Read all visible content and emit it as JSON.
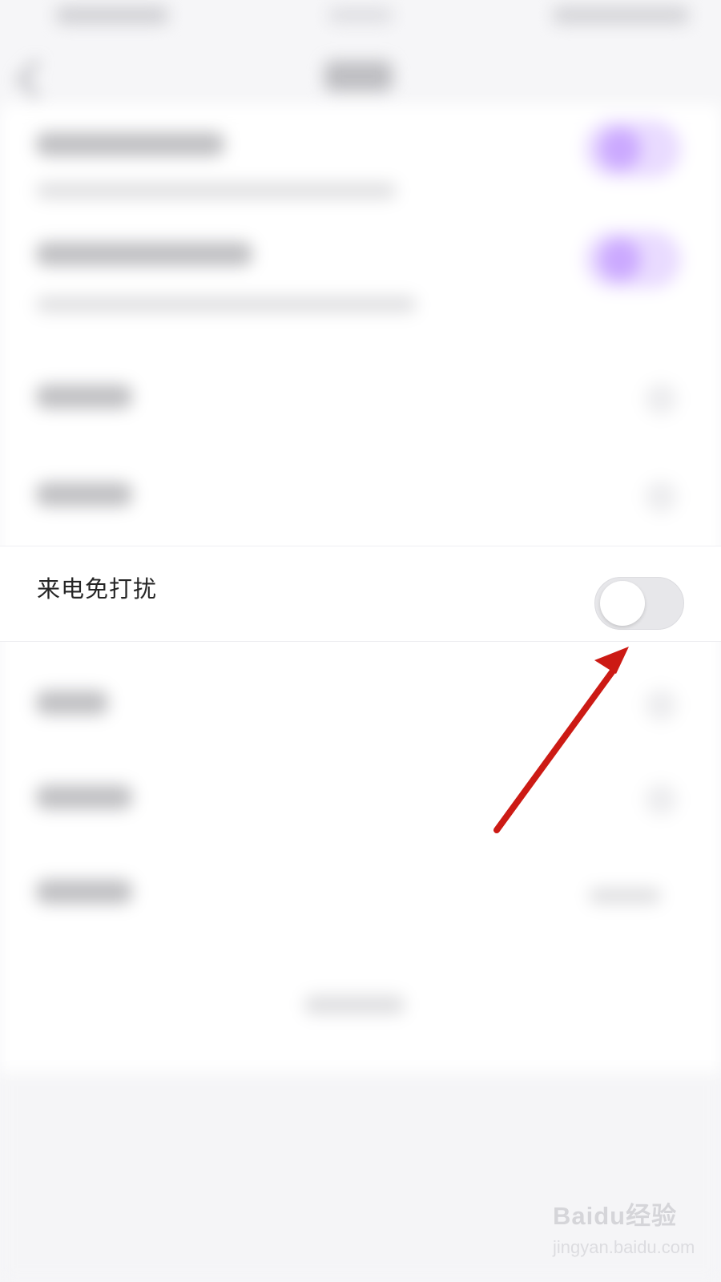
{
  "settings": {
    "call_dnd_label": "来电免打扰",
    "call_dnd_toggle_on": false
  },
  "colors": {
    "arrow": "#cc1a14",
    "toggle_track": "#e7e7ea",
    "toggle_knob": "#ffffff"
  },
  "watermark": {
    "brand": "Baidu经验",
    "site": "jingyan.baidu.com"
  }
}
